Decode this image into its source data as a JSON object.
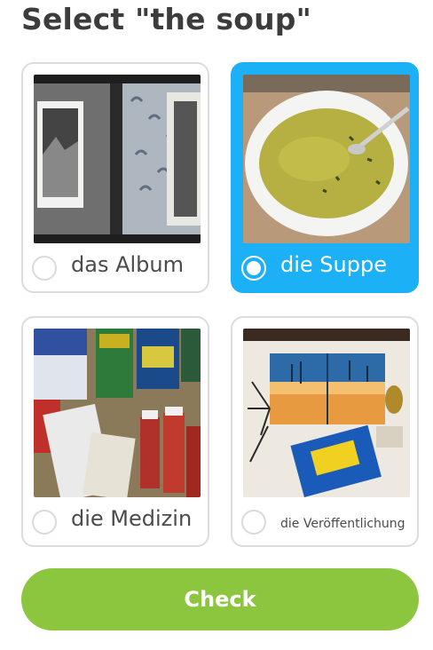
{
  "prompt": {
    "title": "Select \"the soup\""
  },
  "options": [
    {
      "label": "das Album",
      "image": "photo-album-image",
      "selected": false
    },
    {
      "label": "die Suppe",
      "image": "soup-bowl-image",
      "selected": true
    },
    {
      "label": "die Medizin",
      "image": "medicine-bottles-image",
      "selected": false
    },
    {
      "label": "die Veröffentlichung",
      "image": "magazine-publication-image",
      "selected": false
    }
  ],
  "check_button": {
    "label": "Check"
  },
  "colors": {
    "selected": "#1cb0f6",
    "check": "#8cc63f",
    "border": "#dcdcdc",
    "text": "#4b4b4b"
  }
}
